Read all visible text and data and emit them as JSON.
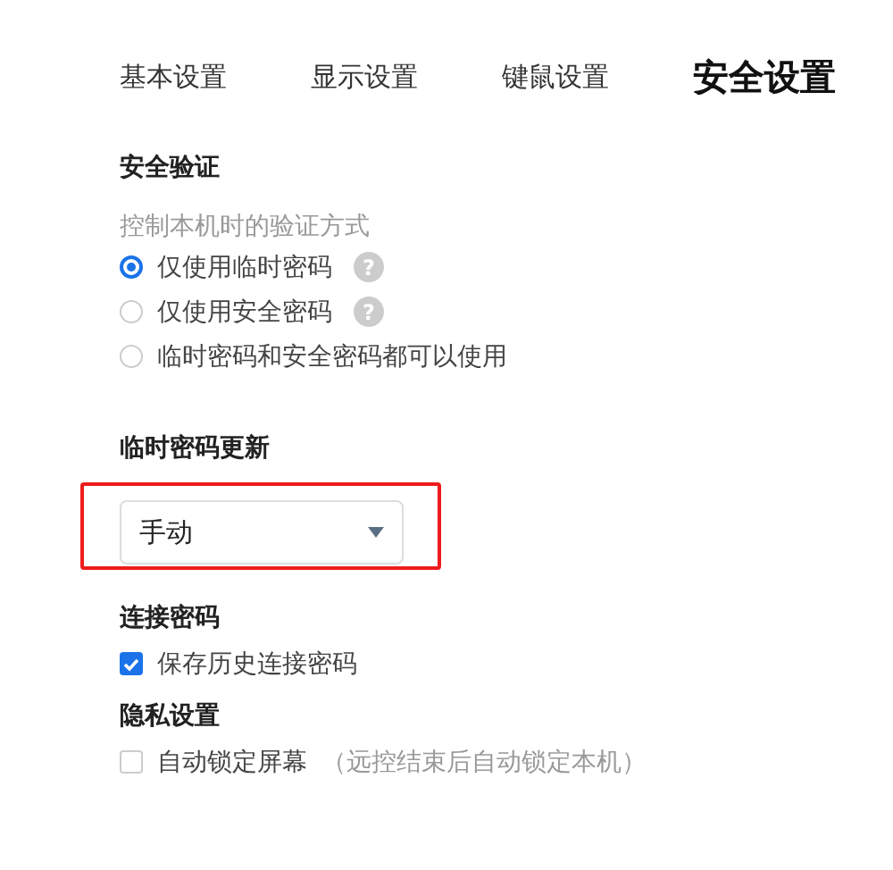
{
  "tabs": [
    {
      "label": "基本设置",
      "selected": false
    },
    {
      "label": "显示设置",
      "selected": false
    },
    {
      "label": "键鼠设置",
      "selected": false
    },
    {
      "label": "安全设置",
      "selected": true
    }
  ],
  "security": {
    "title": "安全验证",
    "description": "控制本机时的验证方式",
    "options": [
      {
        "label": "仅使用临时密码",
        "selected": true,
        "help": "?"
      },
      {
        "label": "仅使用安全密码",
        "selected": false,
        "help": "?"
      },
      {
        "label": "临时密码和安全密码都可以使用",
        "selected": false
      }
    ]
  },
  "temp_password_update": {
    "title": "临时密码更新",
    "value": "手动",
    "highlighted": true
  },
  "connection_password": {
    "title": "连接密码",
    "options": [
      {
        "label": "保存历史连接密码",
        "checked": true
      }
    ]
  },
  "privacy": {
    "title": "隐私设置",
    "options": [
      {
        "label": "自动锁定屏幕",
        "note": "（远控结束后自动锁定本机）",
        "checked": false
      }
    ]
  }
}
